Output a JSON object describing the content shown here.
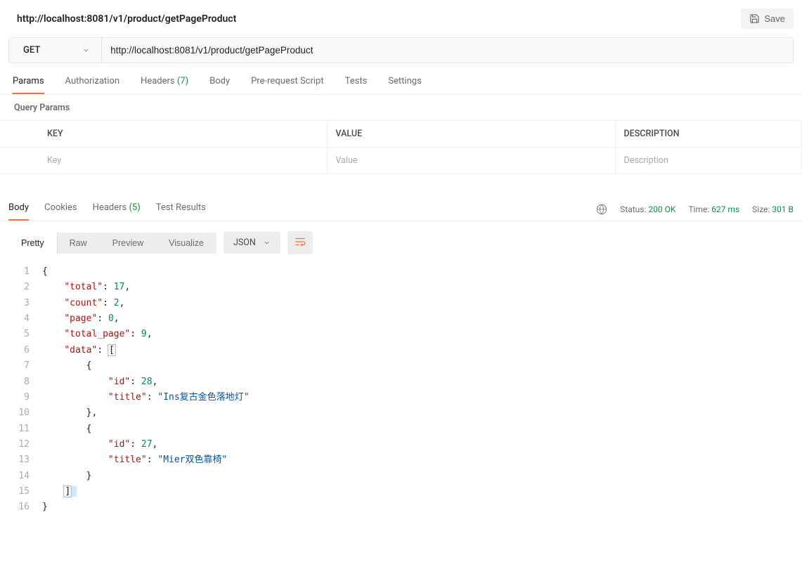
{
  "header": {
    "title": "http://localhost:8081/v1/product/getPageProduct",
    "save_label": "Save"
  },
  "request": {
    "method": "GET",
    "url": "http://localhost:8081/v1/product/getPageProduct"
  },
  "request_tabs": {
    "params": "Params",
    "authorization": "Authorization",
    "headers": "Headers",
    "headers_count": "(7)",
    "body": "Body",
    "prerequest": "Pre-request Script",
    "tests": "Tests",
    "settings": "Settings"
  },
  "query_params": {
    "label": "Query Params",
    "columns": {
      "key": "KEY",
      "value": "VALUE",
      "description": "DESCRIPTION"
    },
    "placeholders": {
      "key": "Key",
      "value": "Value",
      "description": "Description"
    }
  },
  "response_tabs": {
    "body": "Body",
    "cookies": "Cookies",
    "headers": "Headers",
    "headers_count": "(5)",
    "test_results": "Test Results"
  },
  "response_meta": {
    "status_label": "Status:",
    "status_value": "200 OK",
    "time_label": "Time:",
    "time_value": "627 ms",
    "size_label": "Size:",
    "size_value": "301 B"
  },
  "view_modes": {
    "pretty": "Pretty",
    "raw": "Raw",
    "preview": "Preview",
    "visualize": "Visualize",
    "format": "JSON"
  },
  "response_body": {
    "total": 17,
    "count": 2,
    "page": 0,
    "total_page": 9,
    "data": [
      {
        "id": 28,
        "title": "Ins复古金色落地灯"
      },
      {
        "id": 27,
        "title": "Mier双色靠椅"
      }
    ]
  },
  "code_lines": [
    1,
    2,
    3,
    4,
    5,
    6,
    7,
    8,
    9,
    10,
    11,
    12,
    13,
    14,
    15,
    16
  ]
}
